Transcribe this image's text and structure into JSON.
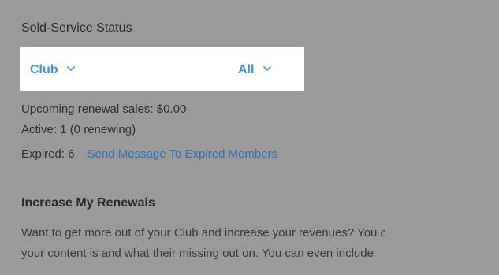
{
  "section": {
    "title": "Sold-Service Status"
  },
  "filters": {
    "club_label": "Club",
    "all_label": "All",
    "chevron_icon": "chevron-down-icon",
    "accent_color": "#3d8fe0"
  },
  "stats": {
    "upcoming_label": "Upcoming renewal sales: $0.00",
    "active_label": "Active: 1 (0 renewing)",
    "expired_label": "Expired: 6",
    "expired_link": "Send Message To Expired Members",
    "link_color": "#2f73c1"
  },
  "renewals": {
    "heading": "Increase My Renewals",
    "body_line_1": "Want to get more out of your Club and increase your revenues? You c",
    "body_line_2": "your content is and what their missing out on. You can even include"
  }
}
